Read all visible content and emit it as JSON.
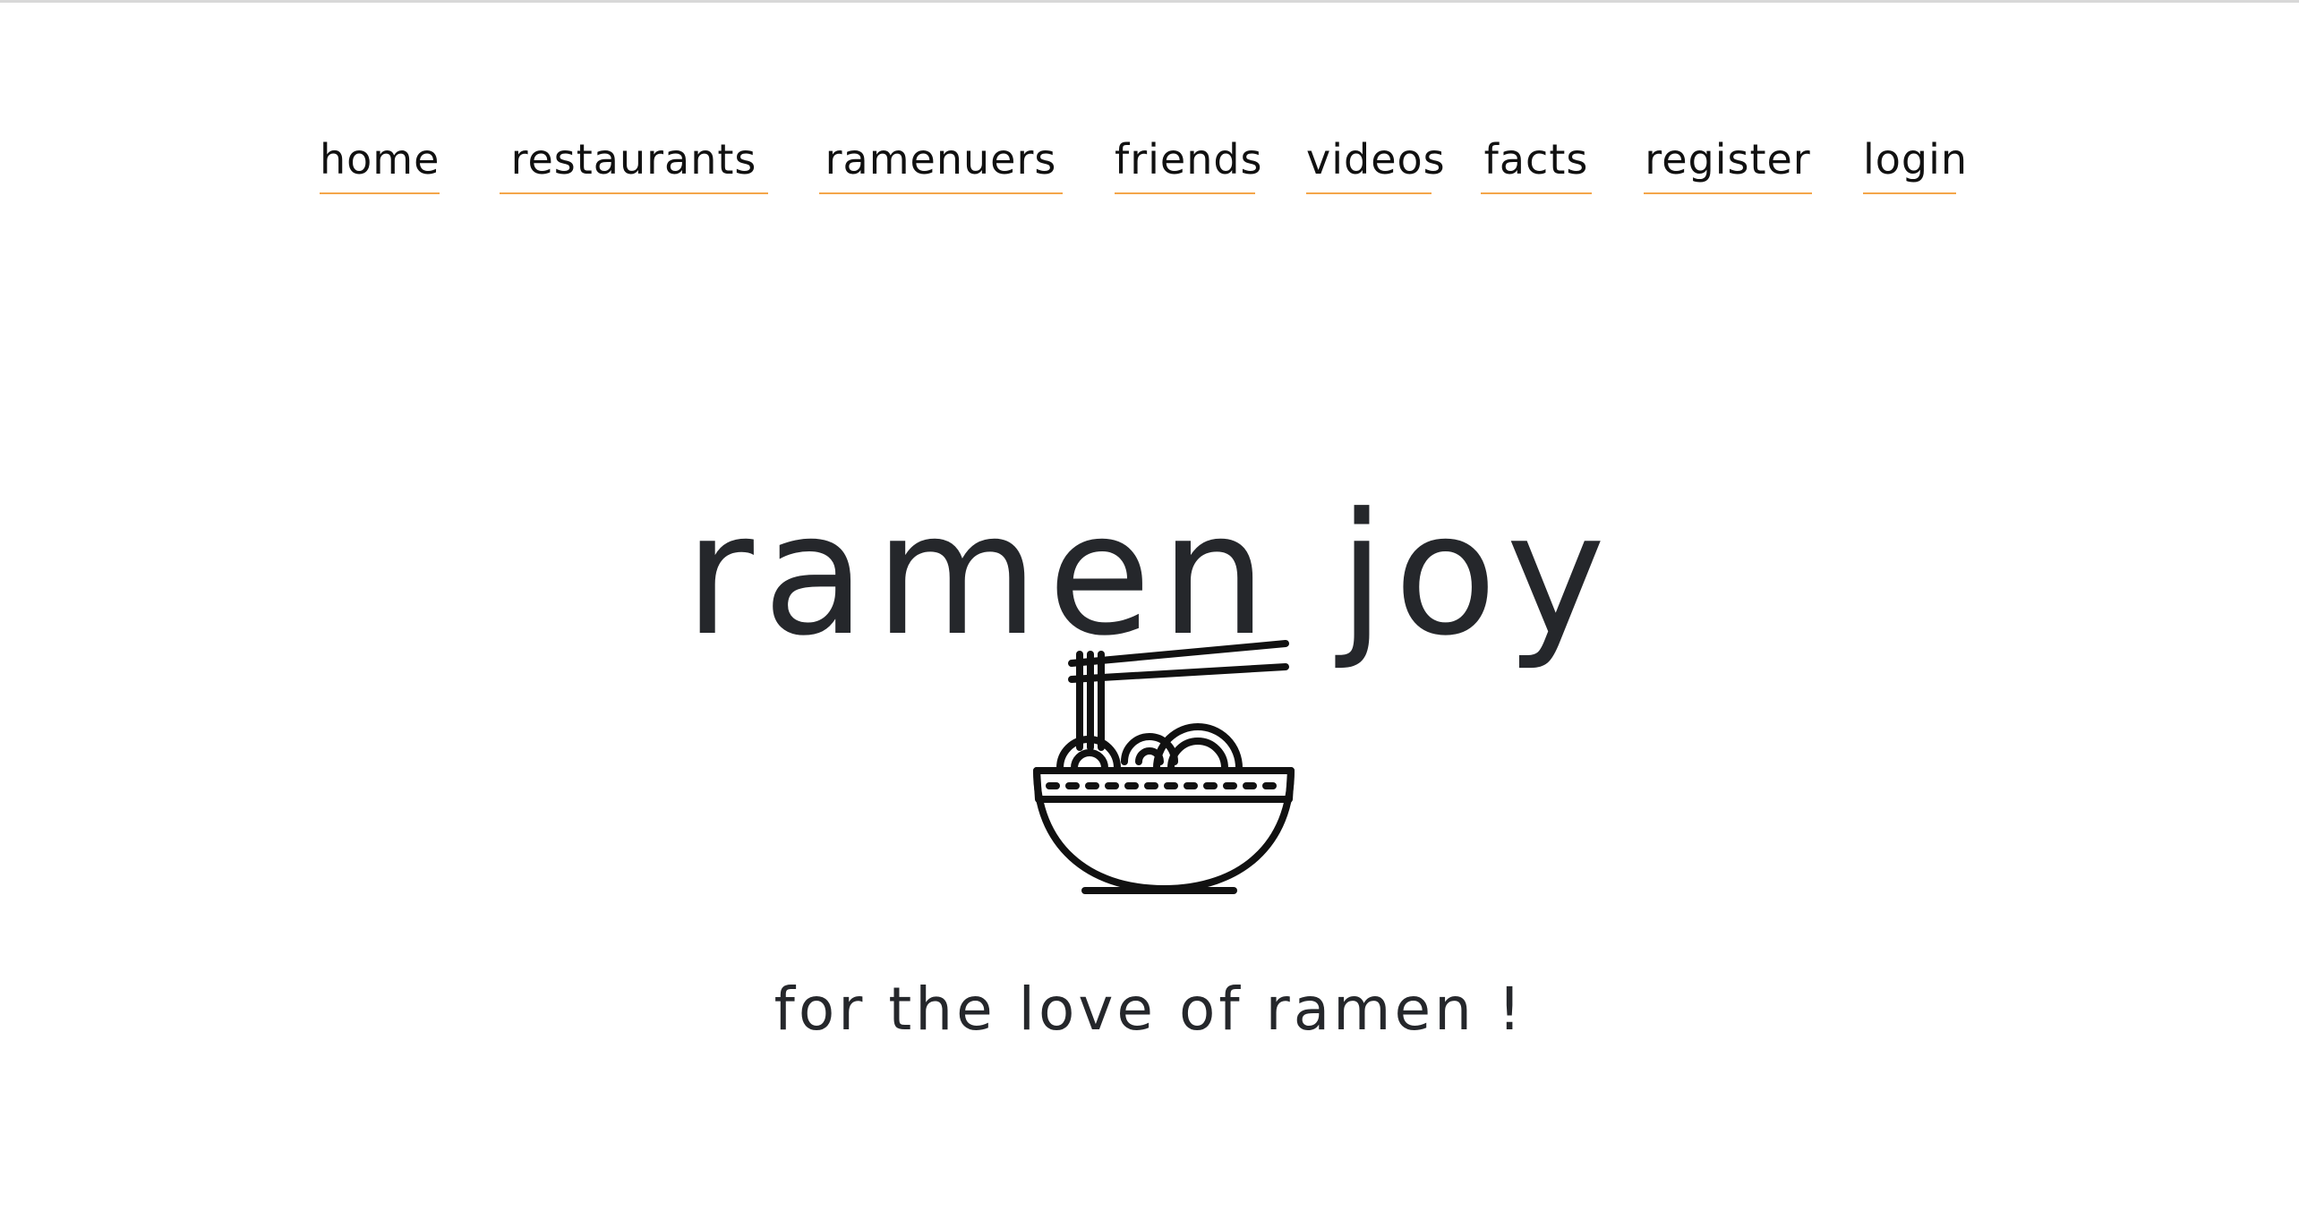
{
  "nav": {
    "items": [
      {
        "label": "home"
      },
      {
        "label": "restaurants"
      },
      {
        "label": "ramenuers"
      },
      {
        "label": "friends"
      },
      {
        "label": "videos"
      },
      {
        "label": "facts"
      },
      {
        "label": "register"
      },
      {
        "label": "login"
      }
    ]
  },
  "hero": {
    "title": "ramen joy",
    "logo_icon": "ramen-bowl-with-chopsticks-icon",
    "tagline": "for the love of ramen !"
  },
  "colors": {
    "accent": "#f4a64a",
    "text": "#25272b",
    "background": "#ffffff"
  }
}
